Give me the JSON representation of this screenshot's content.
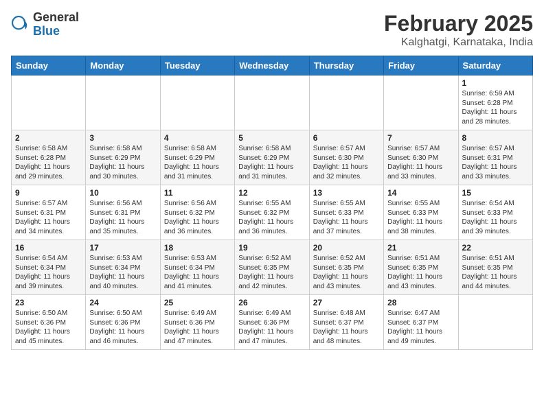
{
  "logo": {
    "general": "General",
    "blue": "Blue"
  },
  "title": "February 2025",
  "subtitle": "Kalghatgi, Karnataka, India",
  "weekdays": [
    "Sunday",
    "Monday",
    "Tuesday",
    "Wednesday",
    "Thursday",
    "Friday",
    "Saturday"
  ],
  "weeks": [
    [
      {
        "day": "",
        "detail": ""
      },
      {
        "day": "",
        "detail": ""
      },
      {
        "day": "",
        "detail": ""
      },
      {
        "day": "",
        "detail": ""
      },
      {
        "day": "",
        "detail": ""
      },
      {
        "day": "",
        "detail": ""
      },
      {
        "day": "1",
        "detail": "Sunrise: 6:59 AM\nSunset: 6:28 PM\nDaylight: 11 hours\nand 28 minutes."
      }
    ],
    [
      {
        "day": "2",
        "detail": "Sunrise: 6:58 AM\nSunset: 6:28 PM\nDaylight: 11 hours\nand 29 minutes."
      },
      {
        "day": "3",
        "detail": "Sunrise: 6:58 AM\nSunset: 6:29 PM\nDaylight: 11 hours\nand 30 minutes."
      },
      {
        "day": "4",
        "detail": "Sunrise: 6:58 AM\nSunset: 6:29 PM\nDaylight: 11 hours\nand 31 minutes."
      },
      {
        "day": "5",
        "detail": "Sunrise: 6:58 AM\nSunset: 6:29 PM\nDaylight: 11 hours\nand 31 minutes."
      },
      {
        "day": "6",
        "detail": "Sunrise: 6:57 AM\nSunset: 6:30 PM\nDaylight: 11 hours\nand 32 minutes."
      },
      {
        "day": "7",
        "detail": "Sunrise: 6:57 AM\nSunset: 6:30 PM\nDaylight: 11 hours\nand 33 minutes."
      },
      {
        "day": "8",
        "detail": "Sunrise: 6:57 AM\nSunset: 6:31 PM\nDaylight: 11 hours\nand 33 minutes."
      }
    ],
    [
      {
        "day": "9",
        "detail": "Sunrise: 6:57 AM\nSunset: 6:31 PM\nDaylight: 11 hours\nand 34 minutes."
      },
      {
        "day": "10",
        "detail": "Sunrise: 6:56 AM\nSunset: 6:31 PM\nDaylight: 11 hours\nand 35 minutes."
      },
      {
        "day": "11",
        "detail": "Sunrise: 6:56 AM\nSunset: 6:32 PM\nDaylight: 11 hours\nand 36 minutes."
      },
      {
        "day": "12",
        "detail": "Sunrise: 6:55 AM\nSunset: 6:32 PM\nDaylight: 11 hours\nand 36 minutes."
      },
      {
        "day": "13",
        "detail": "Sunrise: 6:55 AM\nSunset: 6:33 PM\nDaylight: 11 hours\nand 37 minutes."
      },
      {
        "day": "14",
        "detail": "Sunrise: 6:55 AM\nSunset: 6:33 PM\nDaylight: 11 hours\nand 38 minutes."
      },
      {
        "day": "15",
        "detail": "Sunrise: 6:54 AM\nSunset: 6:33 PM\nDaylight: 11 hours\nand 39 minutes."
      }
    ],
    [
      {
        "day": "16",
        "detail": "Sunrise: 6:54 AM\nSunset: 6:34 PM\nDaylight: 11 hours\nand 39 minutes."
      },
      {
        "day": "17",
        "detail": "Sunrise: 6:53 AM\nSunset: 6:34 PM\nDaylight: 11 hours\nand 40 minutes."
      },
      {
        "day": "18",
        "detail": "Sunrise: 6:53 AM\nSunset: 6:34 PM\nDaylight: 11 hours\nand 41 minutes."
      },
      {
        "day": "19",
        "detail": "Sunrise: 6:52 AM\nSunset: 6:35 PM\nDaylight: 11 hours\nand 42 minutes."
      },
      {
        "day": "20",
        "detail": "Sunrise: 6:52 AM\nSunset: 6:35 PM\nDaylight: 11 hours\nand 43 minutes."
      },
      {
        "day": "21",
        "detail": "Sunrise: 6:51 AM\nSunset: 6:35 PM\nDaylight: 11 hours\nand 43 minutes."
      },
      {
        "day": "22",
        "detail": "Sunrise: 6:51 AM\nSunset: 6:35 PM\nDaylight: 11 hours\nand 44 minutes."
      }
    ],
    [
      {
        "day": "23",
        "detail": "Sunrise: 6:50 AM\nSunset: 6:36 PM\nDaylight: 11 hours\nand 45 minutes."
      },
      {
        "day": "24",
        "detail": "Sunrise: 6:50 AM\nSunset: 6:36 PM\nDaylight: 11 hours\nand 46 minutes."
      },
      {
        "day": "25",
        "detail": "Sunrise: 6:49 AM\nSunset: 6:36 PM\nDaylight: 11 hours\nand 47 minutes."
      },
      {
        "day": "26",
        "detail": "Sunrise: 6:49 AM\nSunset: 6:36 PM\nDaylight: 11 hours\nand 47 minutes."
      },
      {
        "day": "27",
        "detail": "Sunrise: 6:48 AM\nSunset: 6:37 PM\nDaylight: 11 hours\nand 48 minutes."
      },
      {
        "day": "28",
        "detail": "Sunrise: 6:47 AM\nSunset: 6:37 PM\nDaylight: 11 hours\nand 49 minutes."
      },
      {
        "day": "",
        "detail": ""
      }
    ]
  ]
}
